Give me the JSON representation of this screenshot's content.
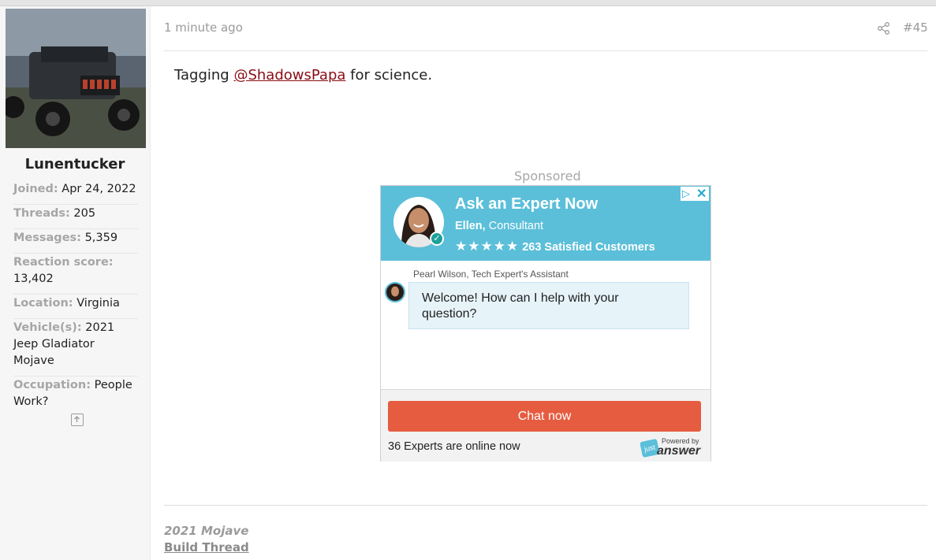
{
  "user": {
    "username": "Lunentucker",
    "fields": [
      {
        "key": "Joined:",
        "value": "Apr 24, 2022"
      },
      {
        "key": "Threads:",
        "value": "205"
      },
      {
        "key": "Messages:",
        "value": "5,359"
      },
      {
        "key": "Reaction score:",
        "value": "13,402"
      },
      {
        "key": "Location:",
        "value": "Virginia"
      },
      {
        "key": "Vehicle(s):",
        "value": "2021 Jeep Gladiator Mojave"
      },
      {
        "key": "Occupation:",
        "value": "People Work?"
      }
    ]
  },
  "post": {
    "time": "1 minute ago",
    "number": "#45",
    "body_prefix": "Tagging ",
    "mention": "@ShadowsPapa",
    "body_suffix": " for science."
  },
  "ad": {
    "sponsored_label": "Sponsored",
    "title": "Ask an Expert Now",
    "expert_name": "Ellen,",
    "expert_role": " Consultant",
    "stars": "★★★★★",
    "rating_text": "263 Satisfied Customers",
    "assistant_name": "Pearl Wilson, Tech Expert's Assistant",
    "welcome_message": "Welcome! How can I help with your question?",
    "chat_button": "Chat now",
    "online_text": "36 Experts are online now",
    "powered_by": "Powered by",
    "brand_just": "just",
    "brand_answer": "answer",
    "header_color": "#5bbfd9",
    "button_color": "#e65c40"
  },
  "signature": {
    "line1": "2021 Mojave",
    "line2": "Build Thread"
  }
}
